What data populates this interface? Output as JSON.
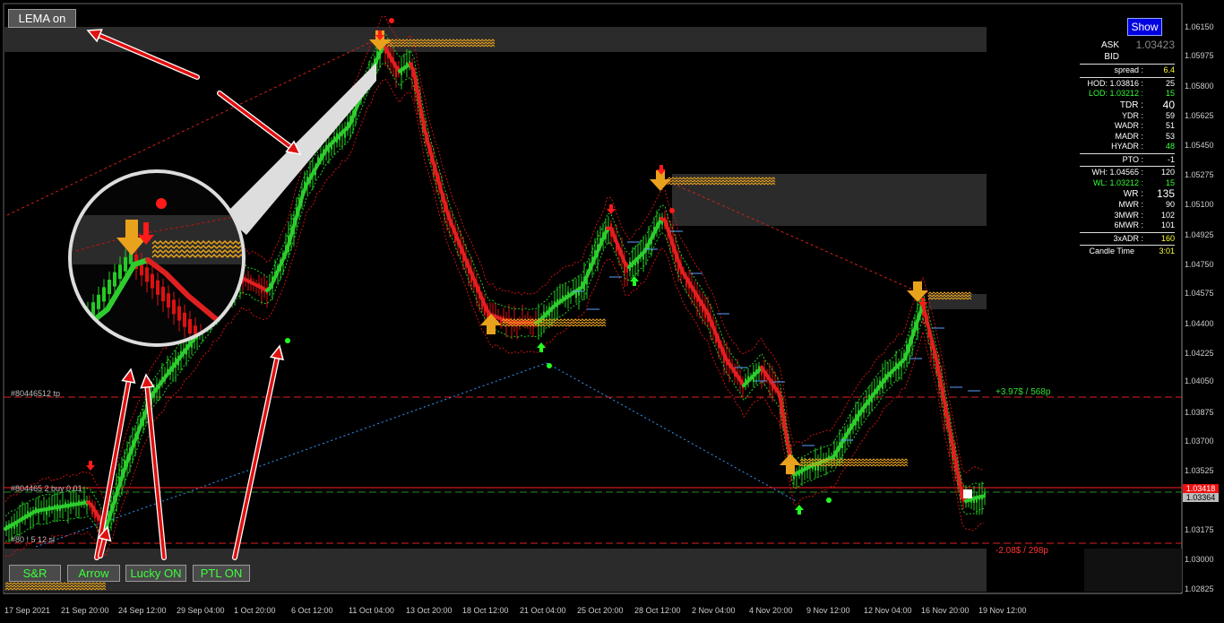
{
  "toolbar": {
    "lema_button": "LEMA on",
    "show_button": "Show"
  },
  "bottom_buttons": [
    "S&R",
    "Arrow",
    "Lucky ON",
    "PTL ON"
  ],
  "orders": {
    "tp_label": "#80446512 tp",
    "buy_label": "#804465 2 buy 0.01",
    "sl_label": "#80 ! 5 12 sl",
    "tp_profit": "+3.97$ / 568p",
    "sl_loss": "-2.08$ / 298p"
  },
  "price_axis": [
    "1.06150",
    "1.05975",
    "1.05800",
    "1.05625",
    "1.05450",
    "1.05275",
    "1.05100",
    "1.04925",
    "1.04750",
    "1.04575",
    "1.04400",
    "1.04225",
    "1.04050",
    "1.03875",
    "1.03700",
    "1.03525",
    "1.03175",
    "1.03000",
    "1.02825"
  ],
  "current_price_tags": {
    "ask": "1.03418",
    "bid": "1.03364"
  },
  "date_axis": [
    "17 Sep 2021",
    "21 Sep 20:00",
    "24 Sep 12:00",
    "29 Sep 04:00",
    "1 Oct 20:00",
    "6 Oct 12:00",
    "11 Oct 04:00",
    "13 Oct 20:00",
    "18 Oct 12:00",
    "21 Oct 04:00",
    "25 Oct 20:00",
    "28 Oct 12:00",
    "2 Nov 04:00",
    "4 Nov 20:00",
    "9 Nov 12:00",
    "12 Nov 04:00",
    "16 Nov 20:00",
    "19 Nov 12:00"
  ],
  "info_panel": {
    "ask_label": "ASK",
    "ask_value": "1.03423",
    "bid_label": "BID",
    "rows": [
      {
        "label": "spread :",
        "value": "6.4",
        "color": "#ffff33",
        "sep_before": true
      },
      {
        "label": "HOD: 1.03816 :",
        "value": "25",
        "color": "#ffffff",
        "sep_before": true
      },
      {
        "label": "LOD: 1.03212 :",
        "value": "15",
        "color": "#33ff33",
        "label_color": "#33ff33"
      },
      {
        "label": "TDR :",
        "value": "40",
        "color": "#ffffff",
        "big": true
      },
      {
        "label": "YDR :",
        "value": "59",
        "color": "#ffffff"
      },
      {
        "label": "WADR :",
        "value": "51",
        "color": "#ffffff"
      },
      {
        "label": "MADR :",
        "value": "53",
        "color": "#ffffff"
      },
      {
        "label": "HYADR :",
        "value": "48",
        "color": "#33ff33"
      },
      {
        "label": "PTO :",
        "value": "-1",
        "color": "#ffffff",
        "sep_before": true
      },
      {
        "label": "WH: 1.04565 :",
        "value": "120",
        "color": "#ffffff",
        "sep_before": true
      },
      {
        "label": "WL: 1.03212 :",
        "value": "15",
        "color": "#33ff33",
        "label_color": "#33ff33"
      },
      {
        "label": "WR :",
        "value": "135",
        "color": "#ffffff",
        "big": true
      },
      {
        "label": "MWR :",
        "value": "90",
        "color": "#ffffff"
      },
      {
        "label": "3MWR :",
        "value": "102",
        "color": "#ffffff"
      },
      {
        "label": "6MWR :",
        "value": "101",
        "color": "#ffffff"
      },
      {
        "label": "3xADR :",
        "value": "160",
        "color": "#ffff33",
        "sep_before": true
      },
      {
        "label": "Candle Time",
        "value": "3:01",
        "color": "#ffff33",
        "sep_before": true
      }
    ]
  },
  "colors": {
    "bull": "#22cc22",
    "bear": "#dd1111",
    "arrow": "#e8a21c",
    "channel_red": "#ff2222",
    "channel_green": "#22ff22"
  }
}
